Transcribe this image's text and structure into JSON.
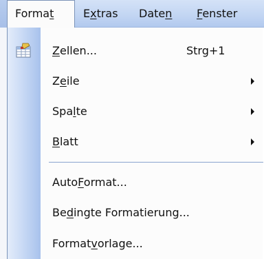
{
  "menubar": {
    "items": [
      {
        "pre": "Forma",
        "u": "t",
        "post": ""
      },
      {
        "pre": "E",
        "u": "x",
        "post": "tras"
      },
      {
        "pre": "Date",
        "u": "n",
        "post": ""
      },
      {
        "pre": "",
        "u": "F",
        "post": "enster"
      }
    ]
  },
  "menu": {
    "items": [
      {
        "pre": "",
        "u": "Z",
        "post": "ellen...",
        "shortcut": "Strg+1",
        "icon": "format-cells-icon",
        "submenu": false
      },
      {
        "pre": "Z",
        "u": "e",
        "post": "ile",
        "shortcut": "",
        "submenu": true
      },
      {
        "pre": "Spa",
        "u": "l",
        "post": "te",
        "shortcut": "",
        "submenu": true
      },
      {
        "pre": "",
        "u": "B",
        "post": "latt",
        "shortcut": "",
        "submenu": true
      },
      {
        "pre": "Auto",
        "u": "F",
        "post": "ormat...",
        "shortcut": "",
        "submenu": false
      },
      {
        "pre": "Be",
        "u": "d",
        "post": "ingte Formatierung...",
        "shortcut": "",
        "submenu": false
      },
      {
        "pre": "Format",
        "u": "v",
        "post": "orlage...",
        "shortcut": "",
        "submenu": false
      }
    ]
  },
  "colors": {
    "menubar": "#c3d6f3",
    "gutter": "#a8c2ec",
    "menu_bg": "#fcfcfc",
    "separator": "#8aa4cf"
  }
}
